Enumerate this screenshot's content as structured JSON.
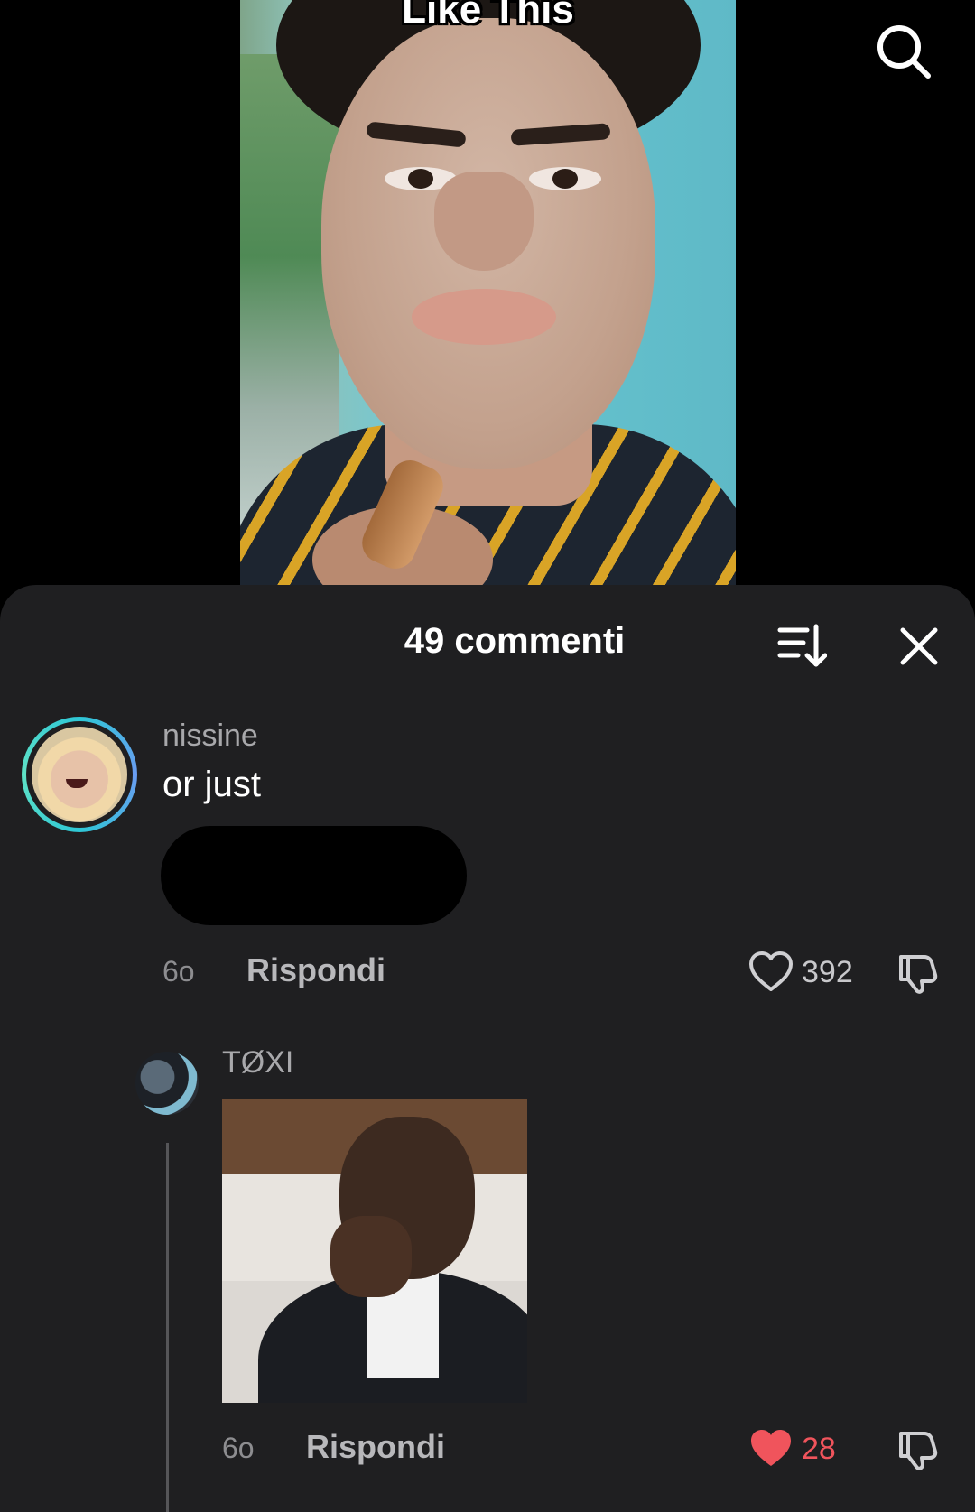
{
  "video": {
    "caption": "Like This"
  },
  "header": {
    "search_icon": "search-icon"
  },
  "comments_panel": {
    "title": "49 commenti",
    "sort_icon": "sort-icon",
    "close_icon": "close-icon"
  },
  "comments": [
    {
      "username": "nissine",
      "text": "or just",
      "time": "6o",
      "reply_label": "Rispondi",
      "likes": "392",
      "liked": false
    }
  ],
  "replies": [
    {
      "username": "TØXI",
      "time": "6o",
      "reply_label": "Rispondi",
      "likes": "28",
      "liked": true
    }
  ],
  "colors": {
    "sheet_bg": "#1f1f21",
    "like_active": "#f0545c",
    "avatar_ring": "#2ec7d6"
  }
}
